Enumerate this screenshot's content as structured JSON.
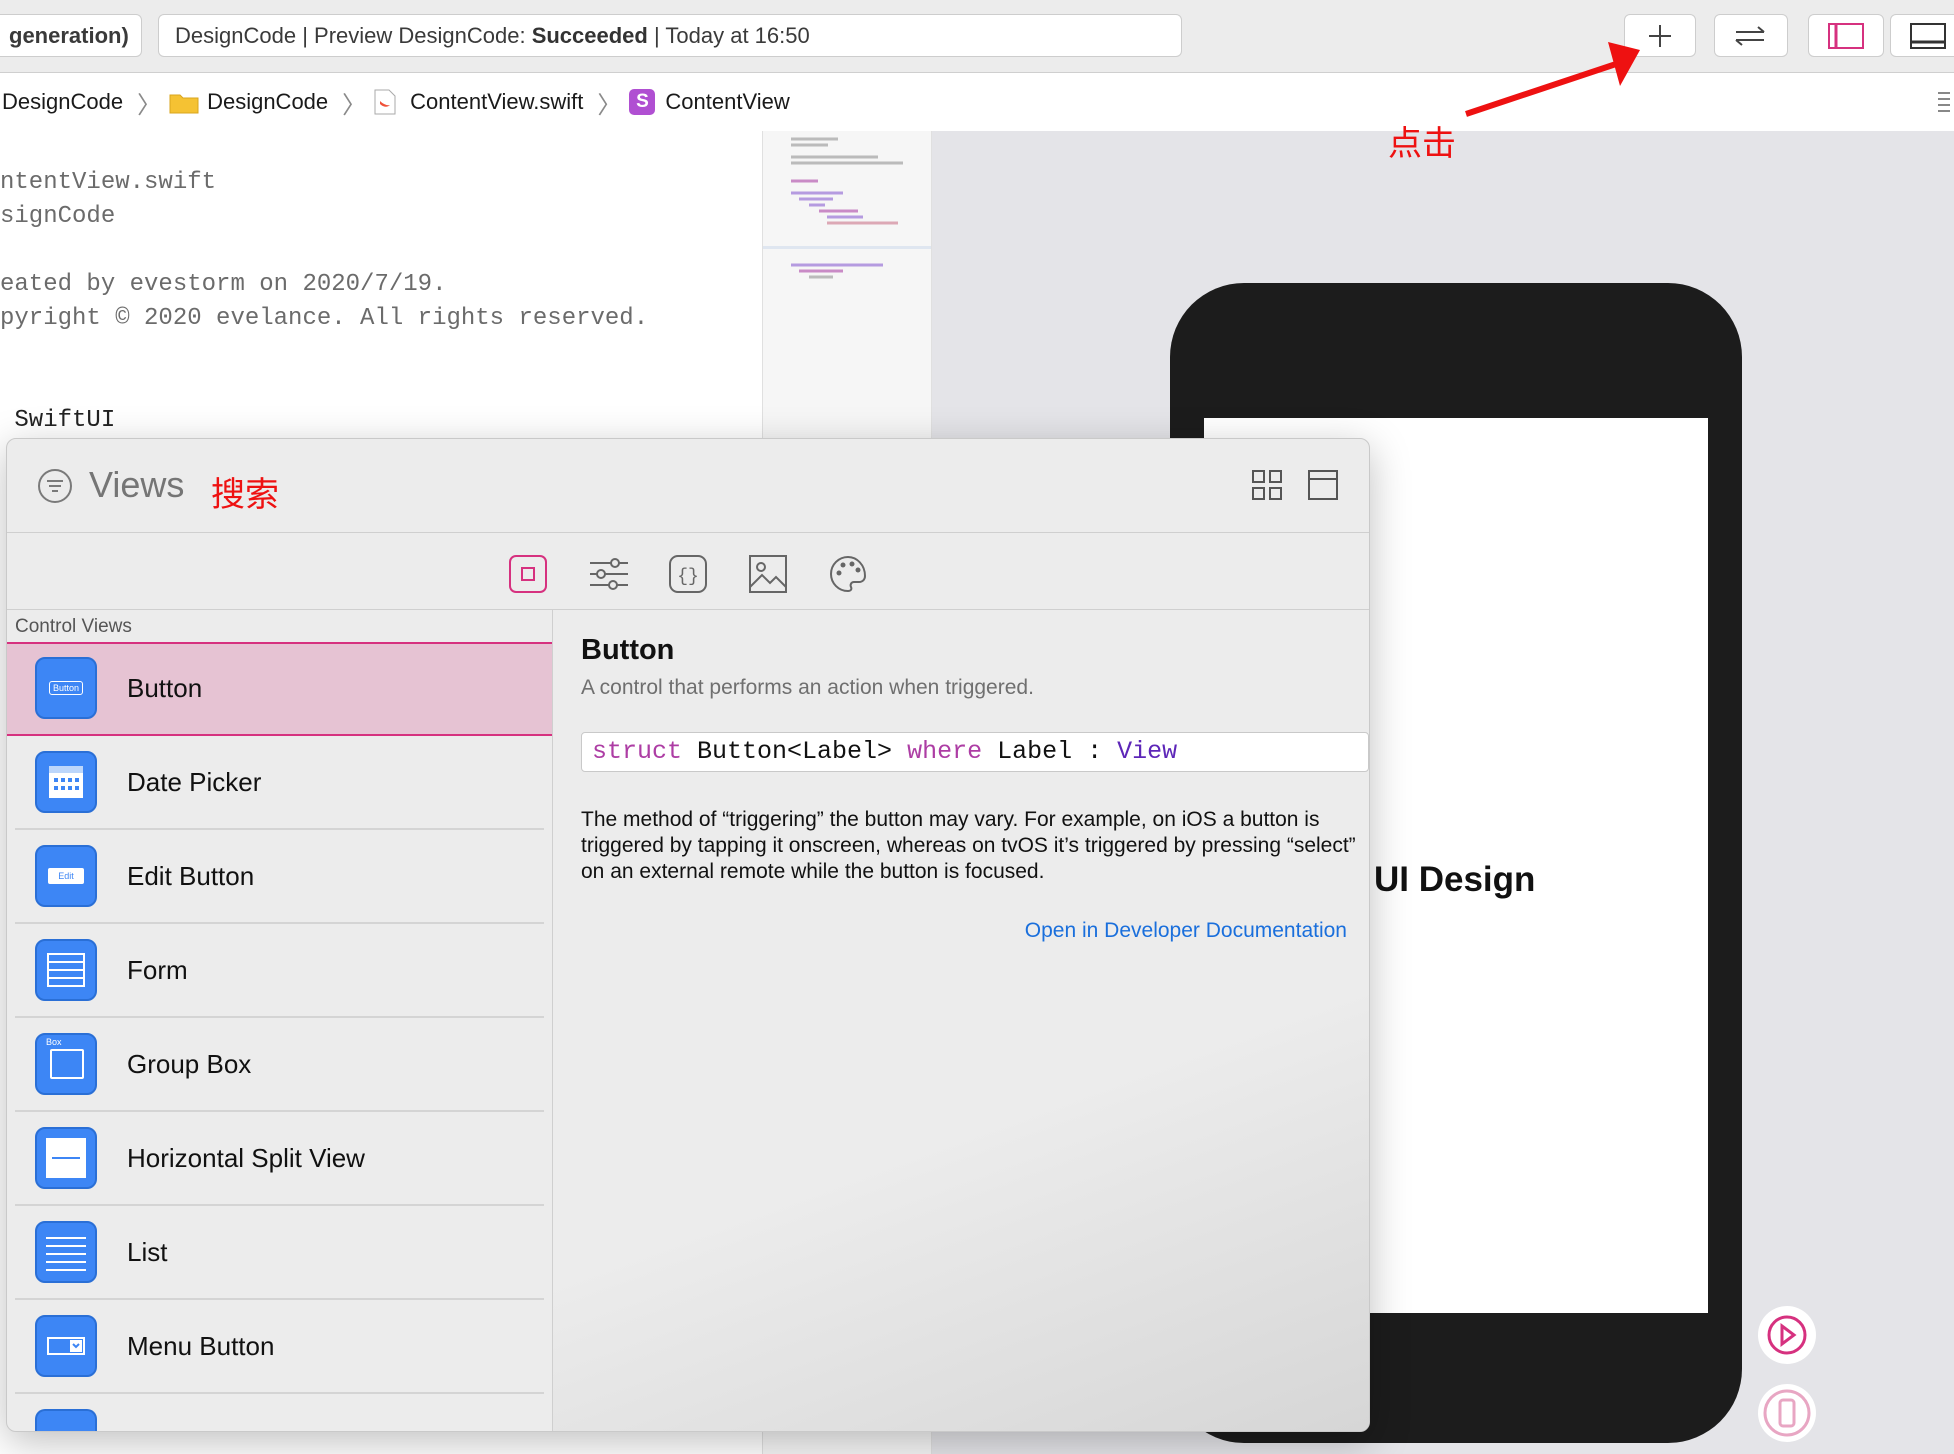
{
  "toolbar": {
    "scheme_label": "generation)",
    "status_prefix": "DesignCode | Preview DesignCode: ",
    "status_bold": "Succeeded",
    "status_suffix": " | Today at 16:50"
  },
  "jumpbar": {
    "crumbs": [
      "DesignCode",
      "DesignCode",
      "ContentView.swift",
      "ContentView"
    ]
  },
  "editor": {
    "lines": [
      "ntentView.swift",
      "signCode",
      "",
      "eated by evestorm on 2020/7/19.",
      "pyright © 2020 evelance. All rights reserved.",
      "",
      "",
      " SwiftUI"
    ]
  },
  "annotations": {
    "click_label": "点击",
    "search_label": "搜索",
    "color": "#ee1111"
  },
  "library": {
    "search_placeholder": "Views",
    "section_header": "Control Views",
    "items": [
      {
        "label": "Button",
        "selected": true
      },
      {
        "label": "Date Picker"
      },
      {
        "label": "Edit Button"
      },
      {
        "label": "Form"
      },
      {
        "label": "Group Box"
      },
      {
        "label": "Horizontal Split View"
      },
      {
        "label": "List"
      },
      {
        "label": "Menu Button"
      }
    ],
    "icon_texts": {
      "button": "Button",
      "edit": "Edit",
      "box": "Box"
    },
    "detail": {
      "title": "Button",
      "subtitle": "A control that performs an action when triggered.",
      "decl": {
        "kw1": "struct",
        "mid": " Button<Label> ",
        "kw2": "where",
        "mid2": " Label : ",
        "type": "View"
      },
      "description": "The method of “triggering” the button may vary. For example, on iOS a button is triggered by tapping it onscreen, whereas on tvOS it’s triggered by pressing “select” on an external remote while the button is focused.",
      "doc_link": "Open in Developer Documentation"
    }
  },
  "preview": {
    "text": "UI Design"
  },
  "colors": {
    "accent_pink": "#d6317f",
    "selected_row": "#e6c3d3",
    "icon_blue": "#3d86f5",
    "link_blue": "#1a6fdc",
    "keyword_purple": "#ad3da4",
    "type_purple": "#5d26b8",
    "preview_text": "#1d2452"
  }
}
